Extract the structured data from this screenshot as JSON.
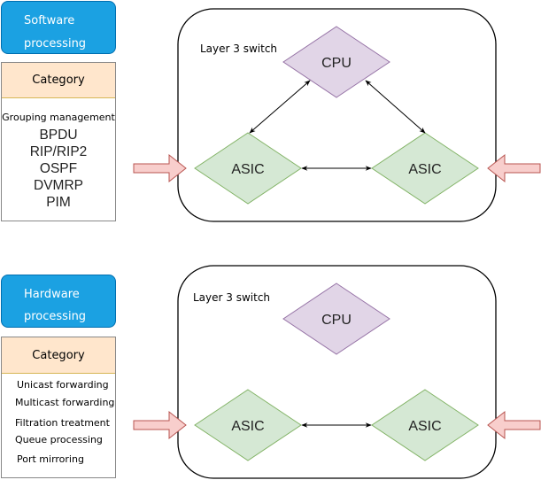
{
  "software": {
    "title_line1": "Software",
    "title_line2": "processing",
    "category_header": "Category",
    "first_item": "Grouping management",
    "items": [
      "BPDU",
      "RIP/RIP2",
      "OSPF",
      "DVMRP",
      "PIM"
    ]
  },
  "hardware": {
    "title_line1": "Hardware",
    "title_line2": "processing",
    "category_header": "Category",
    "items": [
      "Unicast forwarding",
      "Multicast forwarding",
      "Filtration treatment",
      "Queue processing",
      "Port mirroring"
    ]
  },
  "diagram_top": {
    "container_label": "Layer 3 switch",
    "cpu_label": "CPU",
    "asic_left_label": "ASIC",
    "asic_right_label": "ASIC"
  },
  "diagram_bottom": {
    "container_label": "Layer 3 switch",
    "cpu_label": "CPU",
    "asic_left_label": "ASIC",
    "asic_right_label": "ASIC"
  },
  "colors": {
    "blue_fill": "#1ba1e2",
    "category_fill": "#ffe6cc",
    "cpu_fill": "#e1d5e7",
    "cpu_stroke": "#9673a6",
    "asic_fill": "#d5e8d4",
    "asic_stroke": "#82b366",
    "input_arrow_fill": "#f8cecc",
    "input_arrow_stroke": "#b85450"
  }
}
